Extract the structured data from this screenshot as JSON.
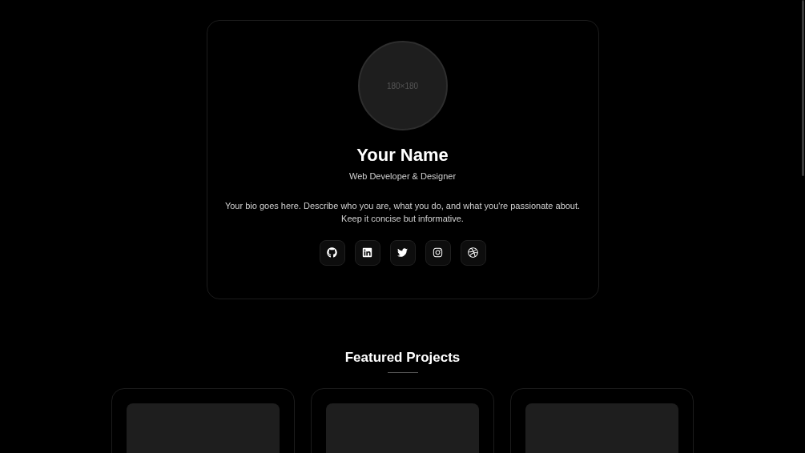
{
  "profile": {
    "avatar_label": "180×180",
    "name": "Your Name",
    "role": "Web Developer & Designer",
    "bio": "Your bio goes here. Describe who you are, what you do, and what you're passionate about. Keep it concise but informative.",
    "social_links": [
      {
        "kind": "github"
      },
      {
        "kind": "linkedin"
      },
      {
        "kind": "twitter"
      },
      {
        "kind": "instagram"
      },
      {
        "kind": "dribbble"
      }
    ]
  },
  "projects": {
    "title": "Featured Projects",
    "items": [
      {
        "kind": "placeholder"
      },
      {
        "kind": "placeholder"
      },
      {
        "kind": "placeholder"
      }
    ]
  }
}
